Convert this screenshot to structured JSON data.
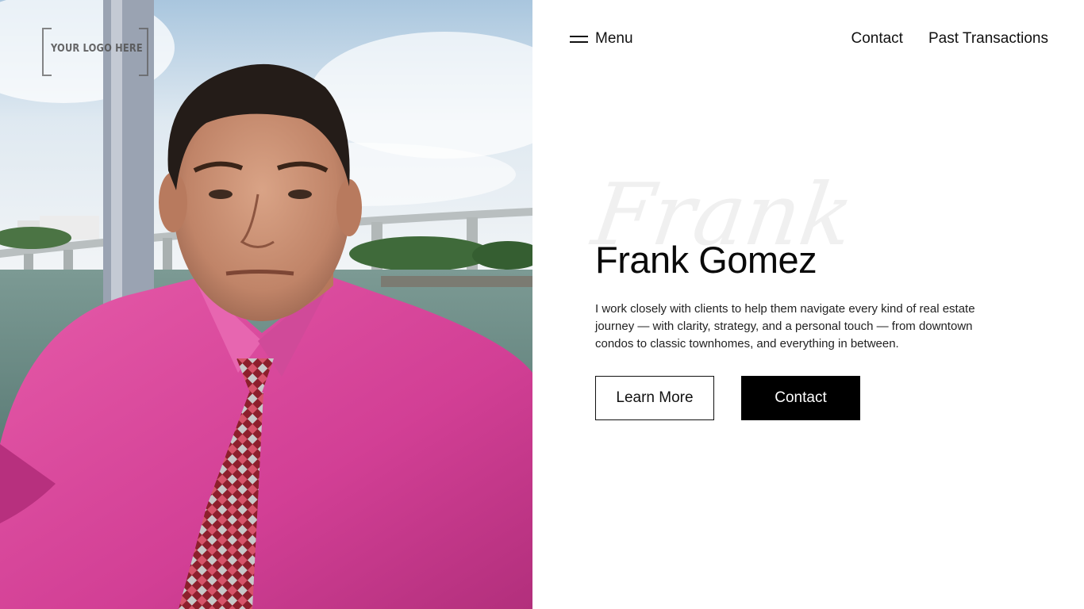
{
  "logo": {
    "text": "YOUR LOGO HERE"
  },
  "nav": {
    "menu_label": "Menu",
    "links": [
      "Contact",
      "Past Transactions"
    ]
  },
  "hero": {
    "script_name": "Frank",
    "name": "Frank Gomez",
    "description": "I work closely with clients to help them navigate every kind of real estate journey — with clarity, strategy, and a personal touch — from downtown condos to classic townhomes, and everything in between.",
    "buttons": {
      "learn_more": "Learn More",
      "contact": "Contact"
    }
  },
  "colors": {
    "primary_button_bg": "#000000",
    "primary_button_text": "#ffffff",
    "shirt": "#d9449a"
  }
}
